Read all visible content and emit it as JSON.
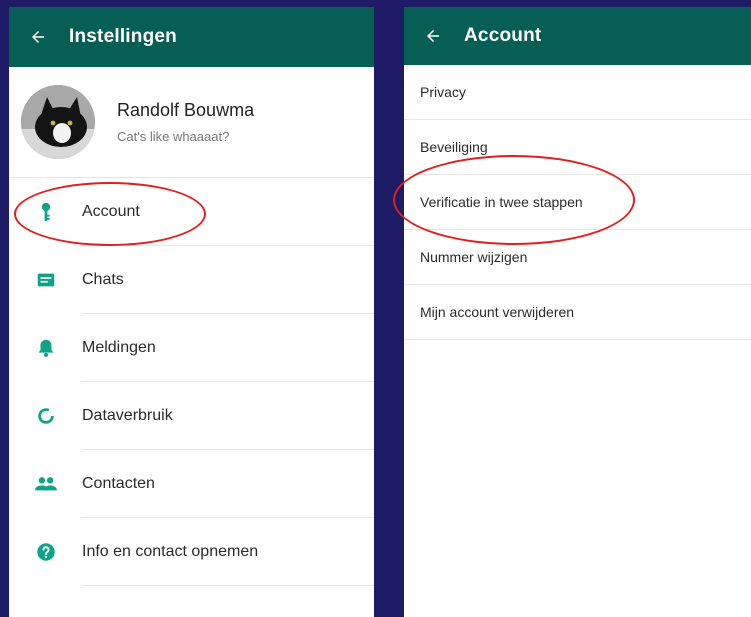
{
  "left_screen": {
    "header_title": "Instellingen",
    "profile": {
      "name": "Randolf Bouwma",
      "status": "Cat's like whaaaat?"
    },
    "items": [
      {
        "label": "Account",
        "icon": "key-icon"
      },
      {
        "label": "Chats",
        "icon": "chat-icon"
      },
      {
        "label": "Meldingen",
        "icon": "bell-icon"
      },
      {
        "label": "Dataverbruik",
        "icon": "data-usage-icon"
      },
      {
        "label": "Contacten",
        "icon": "people-icon"
      },
      {
        "label": "Info en contact opnemen",
        "icon": "help-icon"
      }
    ]
  },
  "right_screen": {
    "header_title": "Account",
    "items": [
      "Privacy",
      "Beveiliging",
      "Verificatie in twee stappen",
      "Nummer wijzigen",
      "Mijn account verwijderen"
    ]
  },
  "colors": {
    "header_bg": "#075e54",
    "icon_teal": "#0fa38a",
    "highlight_red": "#e0201e",
    "backdrop": "#1d1a66"
  }
}
